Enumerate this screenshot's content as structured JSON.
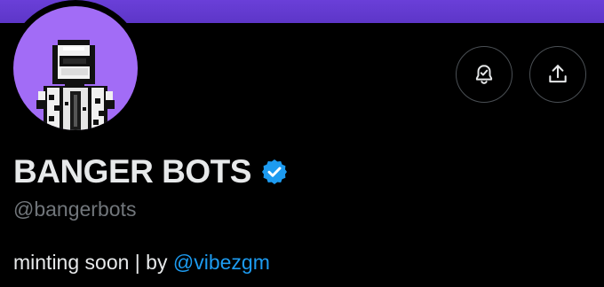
{
  "profile": {
    "display_name": "BANGER BOTS",
    "handle": "@bangerbots",
    "bio_text": "minting soon | by",
    "bio_mention": "@vibezgm",
    "verified": true
  },
  "icons": {
    "notify": "bell-check-icon",
    "share": "share-icon",
    "verified": "verified-badge-icon"
  },
  "colors": {
    "banner": "#5d36c8",
    "avatar_bg": "#a26cf6",
    "text_primary": "#e7e9ea",
    "text_secondary": "#71767b",
    "link": "#1d9bf0",
    "verified": "#1d9bf0",
    "background": "#000000"
  }
}
